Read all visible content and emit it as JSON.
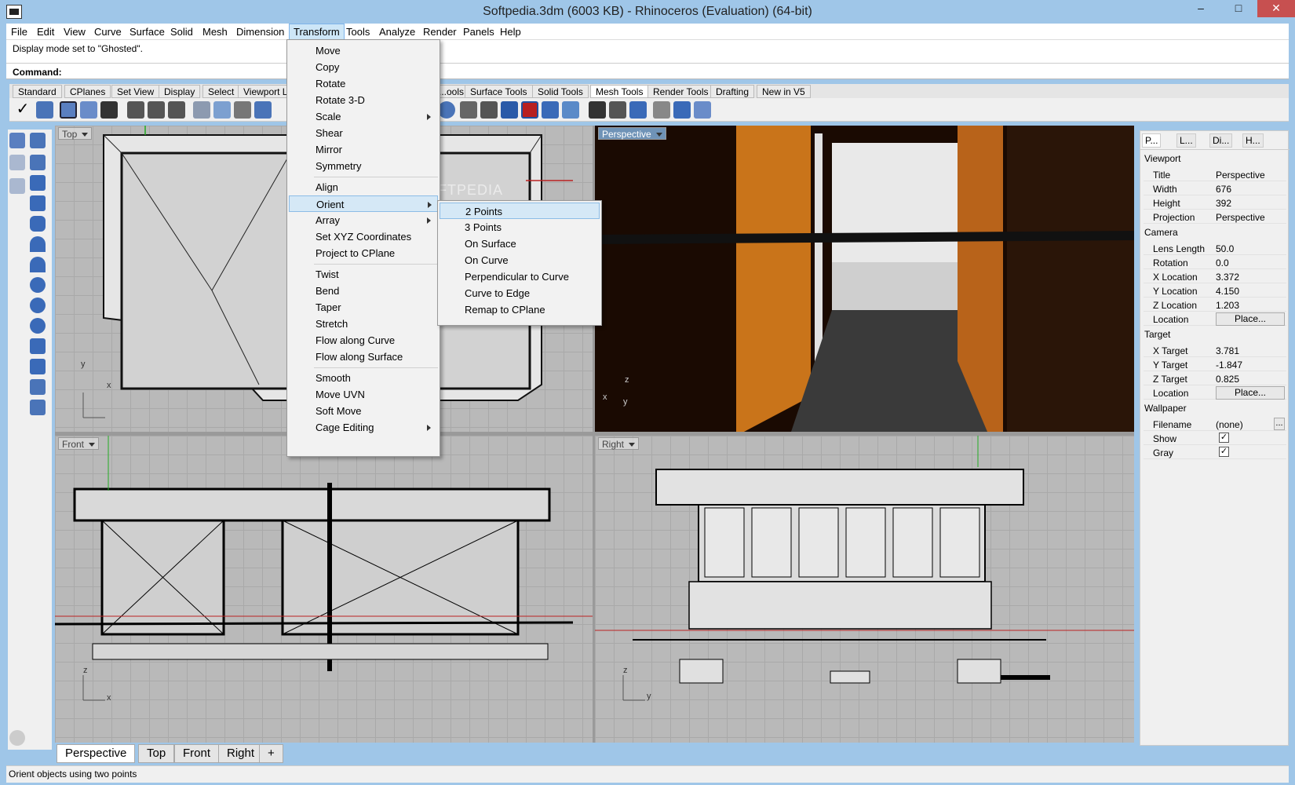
{
  "window": {
    "title": "Softpedia.3dm (6003 KB) - Rhinoceros (Evaluation) (64-bit)",
    "minimize": "–",
    "maximize": "□",
    "close": "✕"
  },
  "menubar": [
    "File",
    "Edit",
    "View",
    "Curve",
    "Surface",
    "Solid",
    "Mesh",
    "Dimension",
    "Transform",
    "Tools",
    "Analyze",
    "Render",
    "Panels",
    "Help"
  ],
  "command": {
    "history": "Display mode set to \"Ghosted\".",
    "label": "Command:",
    "value": ""
  },
  "toolbar_tabs": [
    "Standard",
    "CPlanes",
    "Set View",
    "Display",
    "Select",
    "Viewport La...",
    "...ools",
    "Surface Tools",
    "Solid Tools",
    "Mesh Tools",
    "Render Tools",
    "Drafting",
    "New in V5"
  ],
  "transform_menu": {
    "items": [
      "Move",
      "Copy",
      "Rotate",
      "Rotate 3-D",
      "Scale",
      "Shear",
      "Mirror",
      "Symmetry",
      "Align",
      "Orient",
      "Array",
      "Set XYZ Coordinates",
      "Project to CPlane",
      "Twist",
      "Bend",
      "Taper",
      "Stretch",
      "Flow along Curve",
      "Flow along Surface",
      "Smooth",
      "Move UVN",
      "Soft Move",
      "Cage Editing"
    ],
    "highlighted": "Orient"
  },
  "orient_submenu": {
    "items": [
      "2 Points",
      "3 Points",
      "On Surface",
      "On Curve",
      "Perpendicular to Curve",
      "Curve to Edge",
      "Remap to CPlane"
    ],
    "highlighted": "2 Points"
  },
  "viewports": {
    "top": "Top",
    "perspective": "Perspective",
    "front": "Front",
    "right": "Right"
  },
  "axis_labels": {
    "top_y": "y",
    "top_x": "x",
    "persp_z": "z",
    "persp_x": "x",
    "persp_y": "y",
    "front_z": "z",
    "front_x": "x",
    "right_z": "z",
    "right_y": "y"
  },
  "viewport_tabs": [
    "Perspective",
    "Top",
    "Front",
    "Right",
    "+"
  ],
  "status": "Orient objects using two points",
  "watermark": "SOFTPEDIA",
  "properties_panel": {
    "tabs": [
      "P...",
      "L...",
      "Di...",
      "H..."
    ],
    "viewport_section": "Viewport",
    "title_label": "Title",
    "title_value": "Perspective",
    "width_label": "Width",
    "width_value": "676",
    "height_label": "Height",
    "height_value": "392",
    "projection_label": "Projection",
    "projection_value": "Perspective",
    "camera_section": "Camera",
    "lens_label": "Lens Length",
    "lens_value": "50.0",
    "rotation_label": "Rotation",
    "rotation_value": "0.0",
    "xloc_label": "X Location",
    "xloc_value": "3.372",
    "yloc_label": "Y Location",
    "yloc_value": "4.150",
    "zloc_label": "Z Location",
    "zloc_value": "1.203",
    "loc_label": "Location",
    "place_button": "Place...",
    "target_section": "Target",
    "xt_label": "X Target",
    "xt_value": "3.781",
    "yt_label": "Y Target",
    "yt_value": "-1.847",
    "zt_label": "Z Target",
    "zt_value": "0.825",
    "tloc_label": "Location",
    "tplace_button": "Place...",
    "wallpaper_section": "Wallpaper",
    "filename_label": "Filename",
    "filename_value": "(none)",
    "browse_button": "...",
    "show_label": "Show",
    "show_checked": "✓",
    "gray_label": "Gray",
    "gray_checked": "✓"
  }
}
